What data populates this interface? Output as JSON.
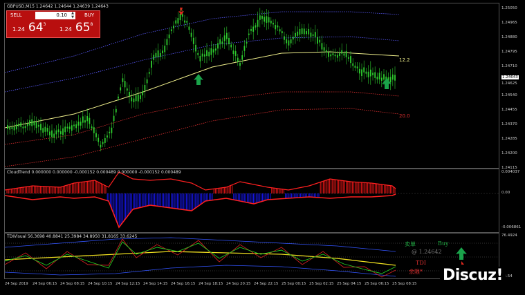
{
  "main_chart": {
    "title": "GBPUSD,M15  1.24642 1.24644 1.24639 1.24643",
    "price_axis": [
      "1.25050",
      "1.24965",
      "1.24880",
      "1.24795",
      "1.24710",
      "1.24643",
      "1.24625",
      "1.24540",
      "1.24455",
      "1.24370",
      "1.24285",
      "1.24200",
      "1.24115"
    ],
    "ma_label_upper": "12.2",
    "ma_label_lower": "20.0",
    "colors": {
      "candles": "#2ecc2e",
      "ma": "#f0f08c",
      "band_blue": "#5a5aff",
      "band_red": "#e03030",
      "arrow_up": "#1aa34a",
      "arrow_down": "#e0281e"
    }
  },
  "trade_panel": {
    "sell_label": "SELL",
    "buy_label": "BUY",
    "lot_value": "0.10",
    "bid_prefix": "1.24",
    "bid_big": "64",
    "bid_sup": "3",
    "ask_prefix": "1.24",
    "ask_big": "65",
    "ask_sup": "8"
  },
  "cloud_indicator": {
    "title": "CloudTrend 0.000000 0.000000 -0.000152 0.000489 0.000000 -0.000152 0.000489",
    "axis": [
      "0.004037",
      "0.00",
      "-0.006861"
    ]
  },
  "tdi_indicator": {
    "title": "TDIVisual 56.3698 40.8841 25.3984 34.8950 31.8165 33.6245",
    "axis": [
      "76.4924",
      "",
      "",
      "14.54"
    ],
    "signal_label_cn": "卖单",
    "signal_side": "Buy",
    "signal_price": "@ 1.24642",
    "tdi_label": "TDI",
    "tdi_sub": "余限*"
  },
  "time_axis": [
    "24 Sep 2019",
    "24 Sep 06:15",
    "24 Sep 08:15",
    "24 Sep 10:15",
    "24 Sep 12:15",
    "24 Sep 14:15",
    "24 Sep 16:15",
    "24 Sep 18:15",
    "24 Sep 20:15",
    "24 Sep 22:15",
    "25 Sep 00:15",
    "25 Sep 02:15",
    "25 Sep 04:15",
    "25 Sep 06:15",
    "25 Sep 08:15"
  ],
  "watermark": "Discuz!"
}
